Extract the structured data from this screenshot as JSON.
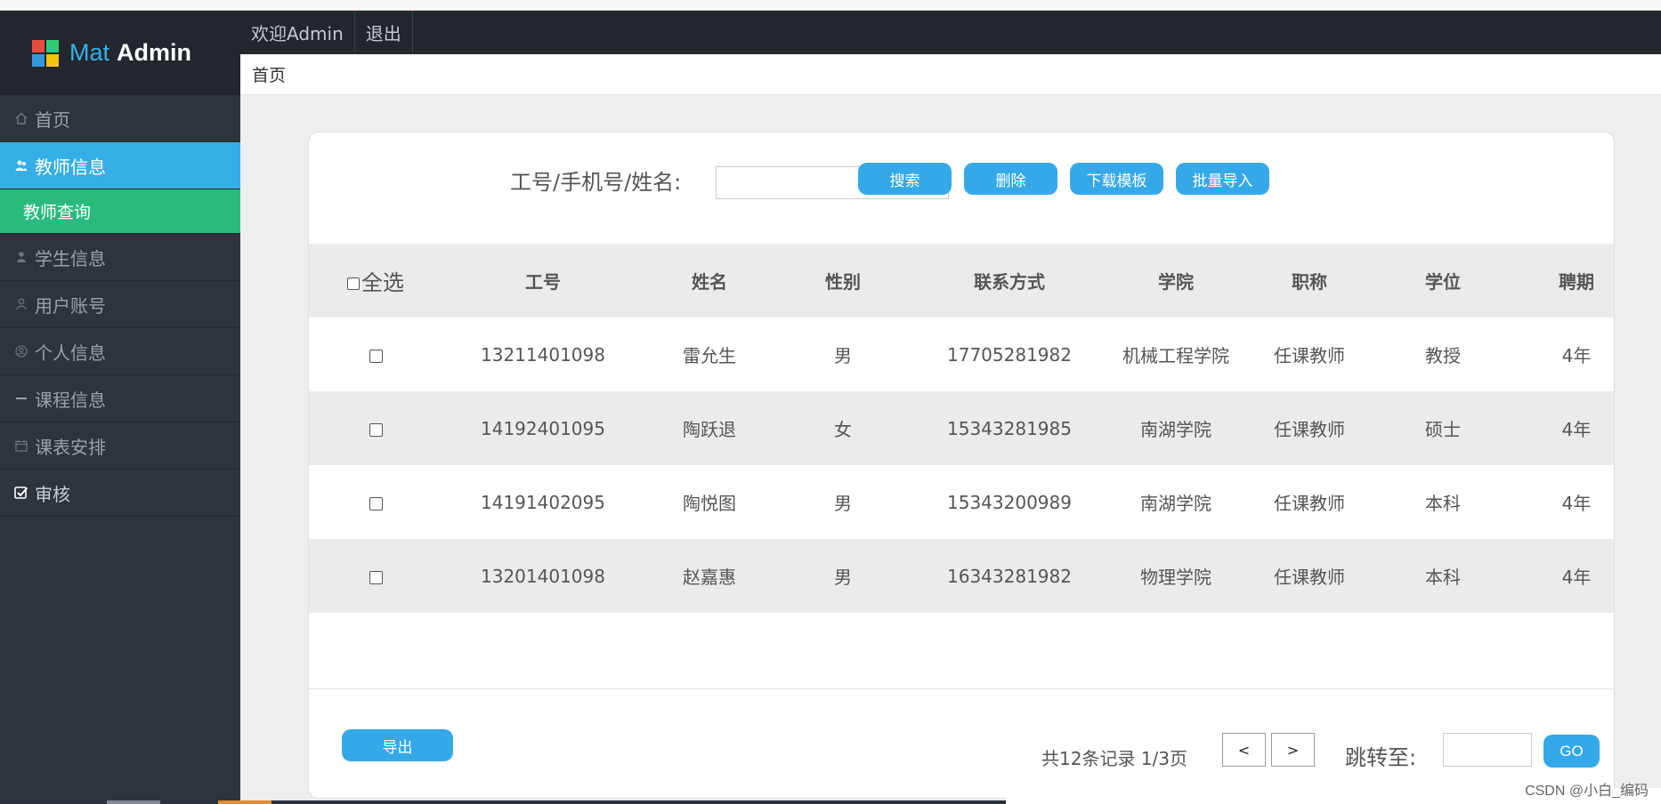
{
  "app": {
    "logo_part1": "Mat",
    "logo_part2": "Admin",
    "logo_colors": [
      "#e84c3d",
      "#2ecc71",
      "#3498db",
      "#f1c40f"
    ]
  },
  "header": {
    "welcome": "欢迎Admin",
    "logout": "退出"
  },
  "breadcrumb": "首页",
  "sidebar": {
    "items": [
      {
        "label": "首页",
        "icon": "home-icon"
      },
      {
        "label": "教师信息",
        "icon": "users-icon"
      },
      {
        "label": "学生信息",
        "icon": "user-icon"
      },
      {
        "label": "用户账号",
        "icon": "user-outline-icon"
      },
      {
        "label": "个人信息",
        "icon": "user-circle-icon"
      },
      {
        "label": "课程信息",
        "icon": "minus-icon"
      },
      {
        "label": "课表安排",
        "icon": "calendar-icon"
      },
      {
        "label": "审核",
        "icon": "check-square-icon"
      }
    ],
    "sub_item": "教师查询"
  },
  "search": {
    "label": "工号/手机号/姓名:",
    "value": ""
  },
  "buttons": {
    "search": "搜索",
    "delete": "删除",
    "download_template": "下载模板",
    "batch_import": "批量导入",
    "export": "导出",
    "go": "GO"
  },
  "table": {
    "headers": [
      "全选",
      "工号",
      "姓名",
      "性别",
      "联系方式",
      "学院",
      "职称",
      "学位",
      "聘期"
    ],
    "rows": [
      [
        "13211401098",
        "雷允生",
        "男",
        "17705281982",
        "机械工程学院",
        "任课教师",
        "教授",
        "4年"
      ],
      [
        "14192401095",
        "陶跃退",
        "女",
        "15343281985",
        "南湖学院",
        "任课教师",
        "硕士",
        "4年"
      ],
      [
        "14191402095",
        "陶悦图",
        "男",
        "15343200989",
        "南湖学院",
        "任课教师",
        "本科",
        "4年"
      ],
      [
        "13201401098",
        "赵嘉惠",
        "男",
        "16343281982",
        "物理学院",
        "任课教师",
        "本科",
        "4年"
      ]
    ]
  },
  "pager": {
    "info": "共12条记录 1/3页",
    "prev": "<",
    "next": ">",
    "jump_label": "跳转至:",
    "jump_value": ""
  },
  "watermark": "CSDN @小白_编码"
}
